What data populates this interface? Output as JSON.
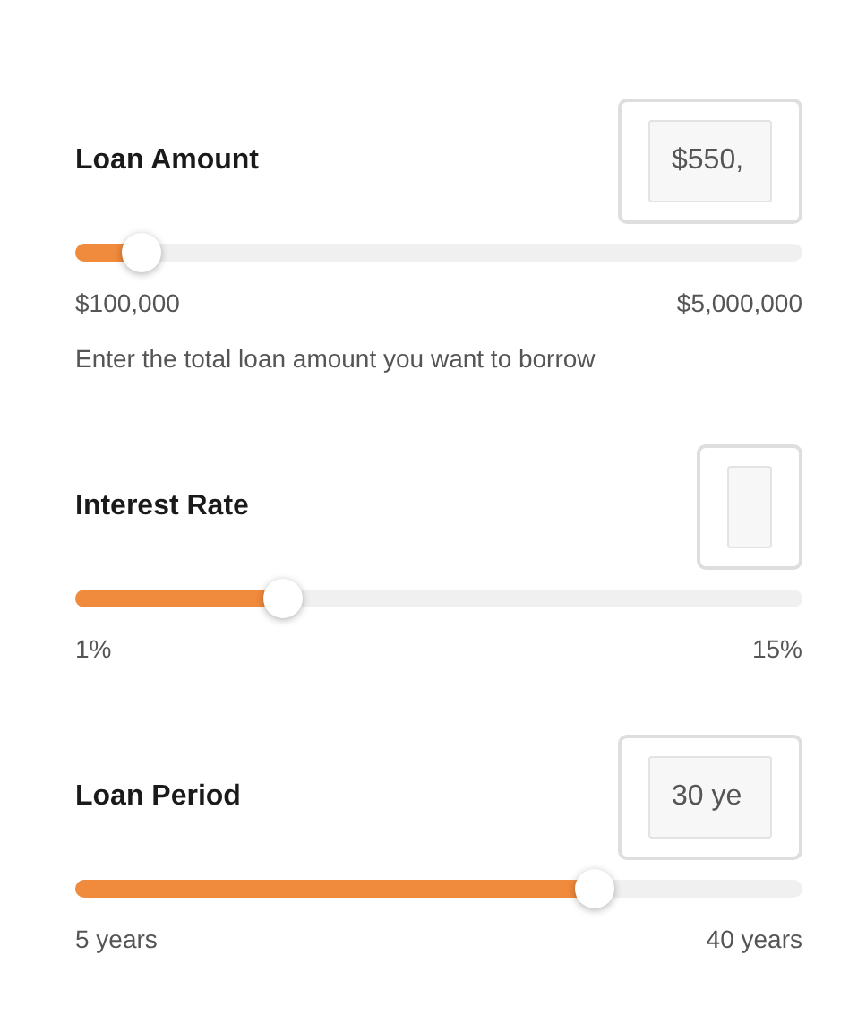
{
  "fields": [
    {
      "label": "Loan Amount",
      "value": "$550,",
      "level": 0.092,
      "min": "$100,000",
      "max": "$5,000,000",
      "help": "Enter the total loan amount you want to borrow"
    },
    {
      "label": "Interest Rate",
      "level": 0.286,
      "min": "1%",
      "max": "15%"
    },
    {
      "label": "Loan Period",
      "value": "30 ye",
      "level": 0.714,
      "min": "5 years",
      "max": "40 years"
    }
  ]
}
